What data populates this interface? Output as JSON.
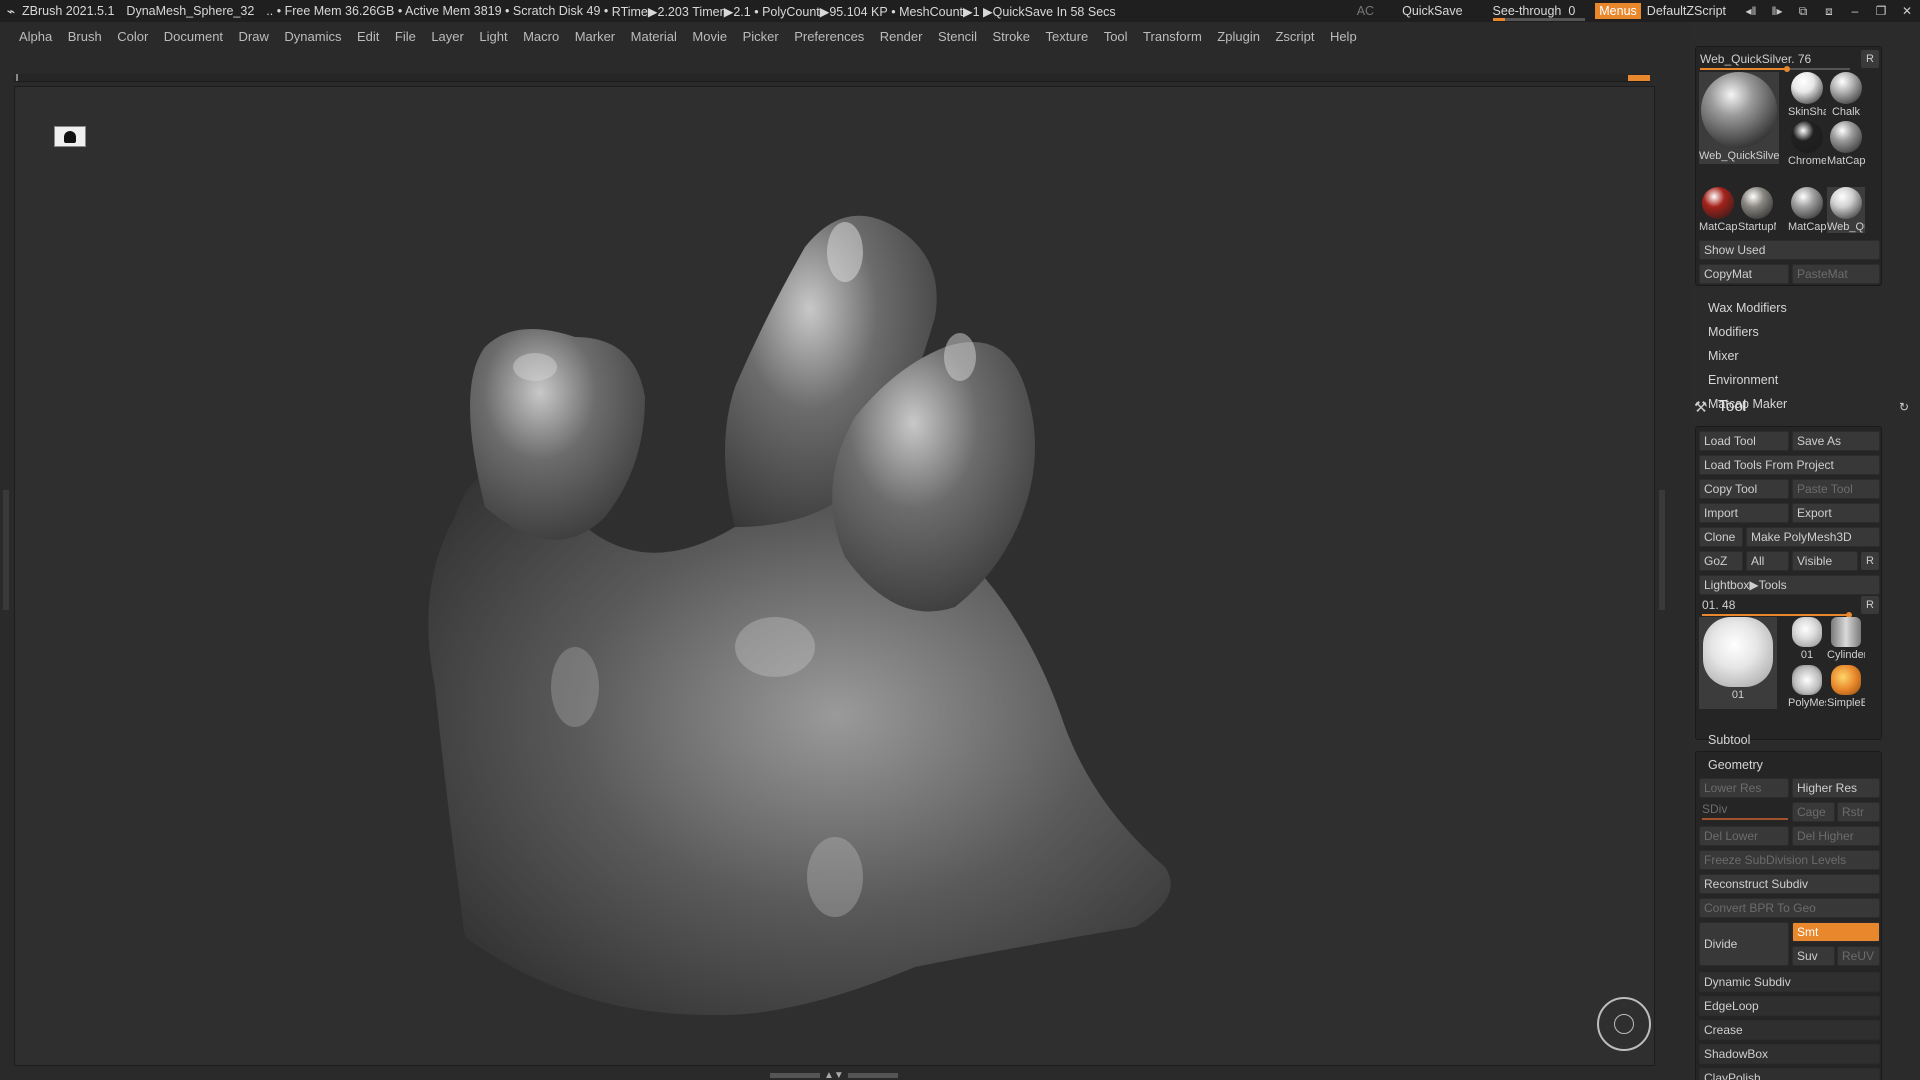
{
  "titlebar": {
    "app": "ZBrush 2021.5.1",
    "document": "DynaMesh_Sphere_32",
    "free_mem": ".. • Free Mem 36.26GB",
    "active_mem": "• Active Mem 3819",
    "scratch": "• Scratch Disk 49 •",
    "rtime": "RTime▶2.203",
    "timer": "Timer▶2.1",
    "polycount": "• PolyCount▶95.104 KP",
    "meshcount": "• MeshCount▶1",
    "quicksave_status": "▶QuickSave In 58 Secs",
    "ac": "AC",
    "quicksave": "QuickSave",
    "see_through": "See-through",
    "see_through_value": "0",
    "see_through_level": 0,
    "menus": "Menus",
    "script": "DefaultZScript"
  },
  "menus": [
    "Alpha",
    "Brush",
    "Color",
    "Document",
    "Draw",
    "Dynamics",
    "Edit",
    "File",
    "Layer",
    "Light",
    "Macro",
    "Marker",
    "Material",
    "Movie",
    "Picker",
    "Preferences",
    "Render",
    "Stencil",
    "Stroke",
    "Texture",
    "Tool",
    "Transform",
    "Zplugin",
    "Zscript",
    "Help"
  ],
  "material": {
    "current": "Web_QuickSilver.",
    "current_value": "76",
    "r": "R",
    "big_label": "Web_QuickSilver",
    "thumbs": [
      {
        "label": "SkinSha",
        "color": "#e8e8e8"
      },
      {
        "label": "Chalk",
        "color": "#b5b5b5"
      },
      {
        "label": "Chrome",
        "color": "#202020"
      },
      {
        "label": "MatCap",
        "color": "#9a9a9a"
      },
      {
        "label": "MatCap",
        "color": "#a3221a"
      },
      {
        "label": "StartupM",
        "color": "#8a8782"
      },
      {
        "label": "MatCap",
        "color": "#a0a0a0"
      },
      {
        "label": "Web_Qu",
        "color": "#d0d0d0"
      }
    ],
    "show_used": "Show Used",
    "copy_mat": "CopyMat",
    "paste_mat": "PasteMat"
  },
  "material_subs": [
    "Wax Modifiers",
    "Modifiers",
    "Mixer",
    "Environment",
    "Matcap Maker"
  ],
  "tool": {
    "title": "Tool",
    "load_tool": "Load Tool",
    "save_as": "Save As",
    "load_from_project": "Load Tools From Project",
    "copy_tool": "Copy Tool",
    "paste_tool": "Paste Tool",
    "import": "Import",
    "export": "Export",
    "clone": "Clone",
    "make_polymesh": "Make PolyMesh3D",
    "goz": "GoZ",
    "all": "All",
    "visible": "Visible",
    "r": "R",
    "lightbox": "Lightbox▶Tools",
    "current": "01.",
    "current_value": "48",
    "thumbs": [
      {
        "label": "01"
      },
      {
        "label": "01"
      },
      {
        "label": "Cylinder"
      },
      {
        "label": "PolyMesh"
      },
      {
        "label": "SimpleB"
      }
    ]
  },
  "subtool": "Subtool",
  "geometry": {
    "title": "Geometry",
    "lower_res": "Lower Res",
    "higher_res": "Higher Res",
    "sdiv": "SDiv",
    "cage": "Cage",
    "rstr": "Rstr",
    "del_lower": "Del Lower",
    "del_higher": "Del Higher",
    "freeze": "Freeze SubDivision Levels",
    "reconstruct": "Reconstruct Subdiv",
    "convert_bpr": "Convert BPR To Geo",
    "divide": "Divide",
    "smt": "Smt",
    "suv": "Suv",
    "reuv": "ReUV",
    "items": [
      "Dynamic Subdiv",
      "EdgeLoop",
      "Crease",
      "ShadowBox",
      "ClayPolish"
    ]
  }
}
